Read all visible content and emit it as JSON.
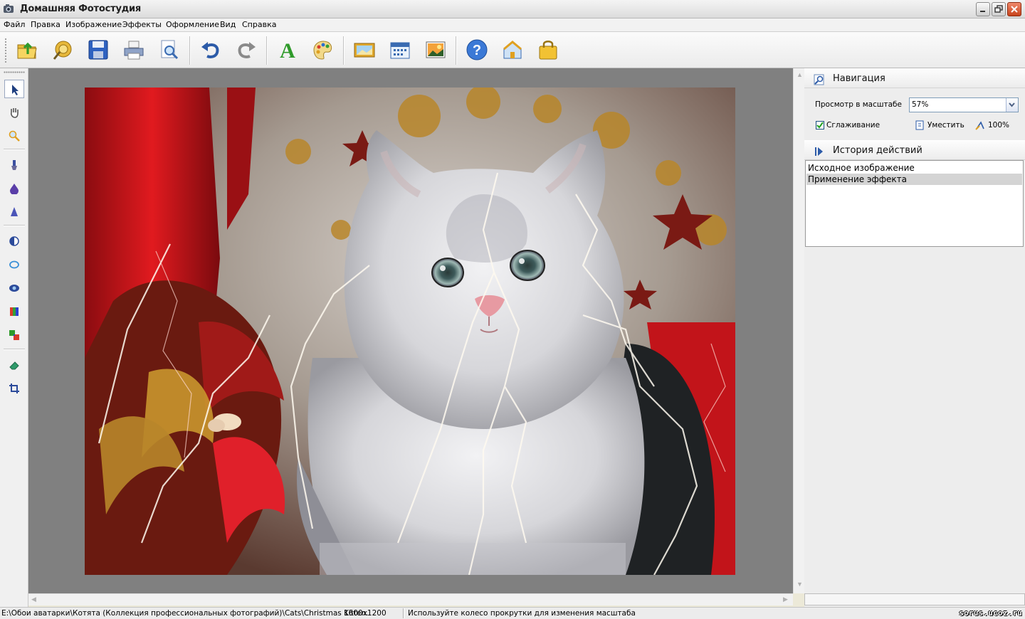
{
  "window": {
    "title": "Домашняя Фотостудия"
  },
  "menu": {
    "items": [
      "Файл",
      "Правка",
      "Изображение",
      "Эффекты",
      "Оформление",
      "Вид",
      "Справка"
    ]
  },
  "toolbar": {
    "buttons": [
      "open-folder-icon",
      "gallery-icon",
      "save-icon",
      "print-icon",
      "preview-icon",
      "undo-icon",
      "redo-icon",
      "text-icon",
      "palette-icon",
      "frame-icon",
      "calendar-icon",
      "image-icon",
      "help-icon",
      "home-icon",
      "bag-icon"
    ]
  },
  "tools": [
    "pointer-tool-icon",
    "hand-tool-icon",
    "zoom-tool-icon",
    "brush-tool-icon",
    "drop-tool-icon",
    "sharpen-tool-icon",
    "contrast-tool-icon",
    "lasso-tool-icon",
    "eye-tool-icon",
    "color-tool-icon",
    "swap-tool-icon",
    "eraser-tool-icon",
    "crop-tool-icon"
  ],
  "navigation": {
    "title": "Навигация",
    "zoom_label": "Просмотр в масштабе",
    "zoom_value": "57%",
    "smoothing_label": "Сглаживание",
    "smoothing_checked": true,
    "fit_label": "Уместить",
    "actual_label": "100%"
  },
  "history": {
    "title": "История действий",
    "items": [
      "Исходное изображение",
      "Применение эффекта"
    ],
    "selected_index": 1
  },
  "status": {
    "path": "E:\\Обои аватарки\\Котята (Коллекция профессиональных фотографий)\\Cats\\Christmas Kitten.",
    "size": "1600x1200",
    "hint": "Используйте колесо прокрутки для изменения масштаба",
    "watermark": "sorus.ucoz.ru"
  },
  "colors": {
    "canvas_bg": "#808080",
    "accent_blue": "#2c5ba8",
    "selection_gray": "#d4d4d4"
  }
}
